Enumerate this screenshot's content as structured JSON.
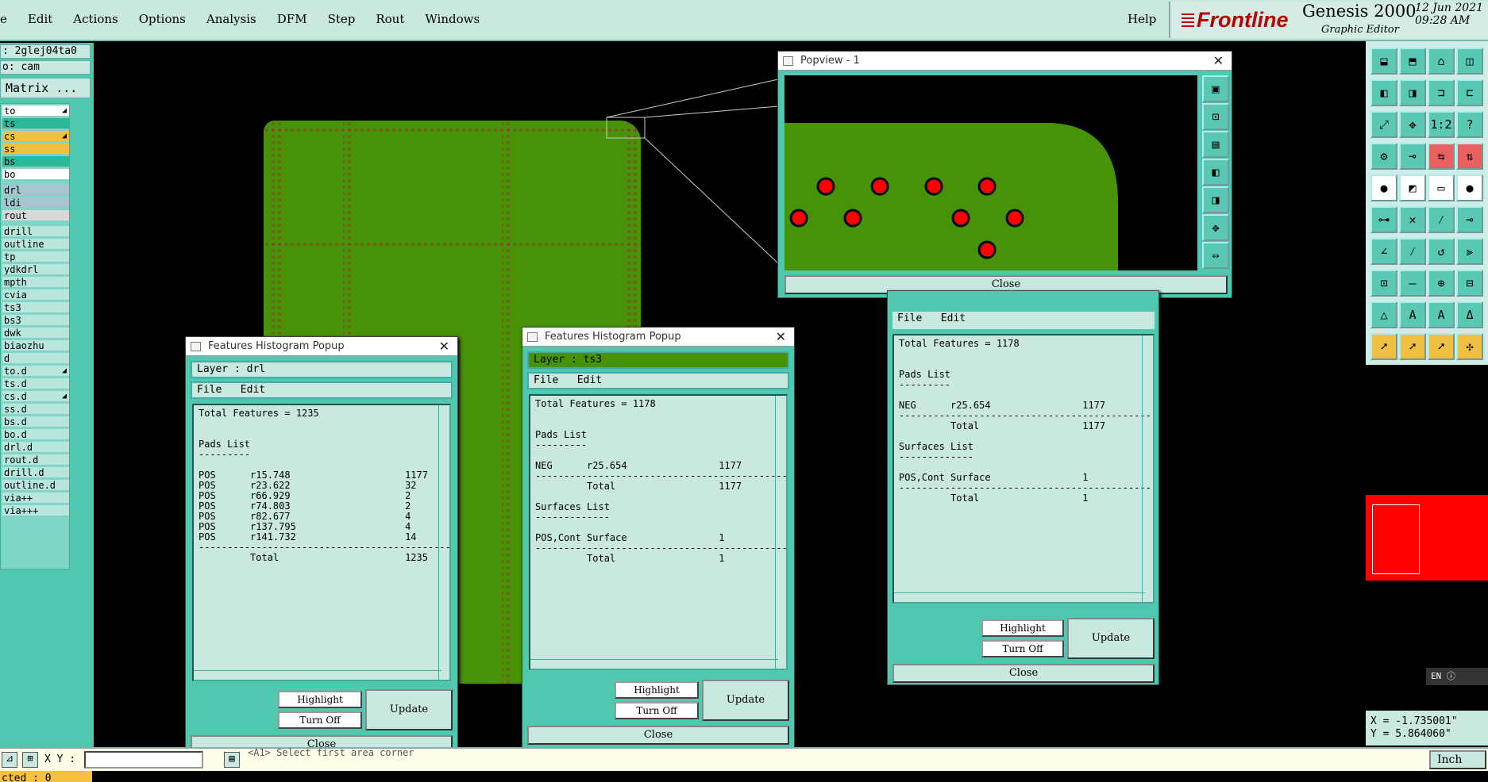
{
  "menubar": {
    "items": [
      "e",
      "Edit",
      "Actions",
      "Options",
      "Analysis",
      "DFM",
      "Step",
      "Rout",
      "Windows"
    ],
    "help": "Help",
    "logo": "Frontline",
    "product": "Genesis 2000",
    "subtitle": "Graphic Editor",
    "date": "12 Jun 2021",
    "time": "09:28 AM"
  },
  "left_panel": {
    "job": ": 2glej04ta0",
    "step": "o: cam",
    "matrix_button": "Matrix ...",
    "layers": [
      "to",
      "ts",
      "cs",
      "ss",
      "bs",
      "bo",
      "drl",
      "ldi",
      "rout",
      "drill",
      "outline",
      "tp",
      "ydkdrl",
      "mpth",
      "cvia",
      "ts3",
      "bs3",
      "dwk",
      "biaozhu",
      "d",
      "to.d",
      "ts.d",
      "cs.d",
      "ss.d",
      "bs.d",
      "bo.d",
      "drl.d",
      "rout.d",
      "drill.d",
      "outline.d",
      "via++",
      "via+++"
    ],
    "selected": "cted : 0"
  },
  "popview": {
    "title": "Popview - 1",
    "close": "Close"
  },
  "hist1": {
    "title": "Features Histogram Popup",
    "layer": "Layer :  drl",
    "menu": [
      "File",
      "Edit"
    ],
    "report": "Total Features = 1235\n\n\nPads List\n---------\n\nPOS      r15.748                    1177\nPOS      r23.622                    32\nPOS      r66.929                    2\nPOS      r74.803                    2\nPOS      r82.677                    4\nPOS      r137.795                   4\nPOS      r141.732                   14\n--------------------------------------------\n         Total                      1235",
    "highlight": "Highlight",
    "turn_off": "Turn Off",
    "update": "Update",
    "close": "Close"
  },
  "hist2": {
    "title": "Features Histogram Popup",
    "layer": "Layer :  ts3",
    "menu": [
      "File",
      "Edit"
    ],
    "report": "Total Features = 1178\n\n\nPads List\n---------\n\nNEG      r25.654                1177\n--------------------------------------------\n         Total                  1177\n\nSurfaces List\n-------------\n\nPOS,Cont Surface                1\n--------------------------------------------\n         Total                  1",
    "highlight": "Highlight",
    "turn_off": "Turn Off",
    "update": "Update",
    "close": "Close"
  },
  "hist3": {
    "menu": [
      "File",
      "Edit"
    ],
    "report": "Total Features = 1178\n\n\nPads List\n---------\n\nNEG      r25.654                1177\n--------------------------------------------\n         Total                  1177\n\nSurfaces List\n-------------\n\nPOS,Cont Surface                1\n--------------------------------------------\n         Total                  1",
    "highlight": "Highlight",
    "turn_off": "Turn Off",
    "update": "Update",
    "close": "Close"
  },
  "coords": {
    "x": "X = -1.735001\"",
    "y": "Y = 5.864060\""
  },
  "status_bar": {
    "xy_label": "X Y :",
    "prompt": "<A1> Select first area corner",
    "units": "Inch",
    "lang": "EN"
  },
  "colors": {
    "board": "#489208",
    "panel": "#50c8b0",
    "pad": "#ff0000"
  }
}
